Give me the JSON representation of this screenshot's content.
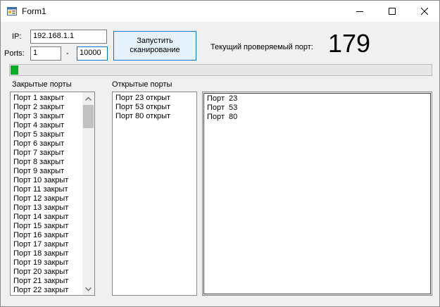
{
  "window": {
    "title": "Form1"
  },
  "form": {
    "ip_label": "IP:",
    "ip_value": "192.168.1.1",
    "ports_label": "Ports:",
    "port_from": "1",
    "port_separator": "-",
    "port_to": "10000",
    "scan_button_line1": "Запустить",
    "scan_button_line2": "сканирование",
    "current_port_label": "Текущий проверяемый порт:",
    "current_port_value": "179",
    "progress_percent": 1.8
  },
  "closed_ports": {
    "label": "Закрытые порты",
    "items": [
      "Порт 1 закрыт",
      "Порт 2 закрыт",
      "Порт 3 закрыт",
      "Порт 4 закрыт",
      "Порт 5 закрыт",
      "Порт 6 закрыт",
      "Порт 7 закрыт",
      "Порт 8 закрыт",
      "Порт 9 закрыт",
      "Порт 10 закрыт",
      "Порт 11 закрыт",
      "Порт 12 закрыт",
      "Порт 13 закрыт",
      "Порт 14 закрыт",
      "Порт 15 закрыт",
      "Порт 16 закрыт",
      "Порт 17 закрыт",
      "Порт 18 закрыт",
      "Порт 19 закрыт",
      "Порт 20 закрыт",
      "Порт 21 закрыт",
      "Порт 22 закрыт"
    ]
  },
  "open_ports": {
    "label": "Открытые порты",
    "items": [
      "Порт 23 открыт",
      "Порт 53 открыт",
      "Порт 80 открыт"
    ]
  },
  "ports_text": {
    "lines": [
      "Порт  23",
      "Порт  53",
      "Порт  80"
    ]
  },
  "icons": {
    "app": "form-app-icon",
    "minimize": "minimize-icon",
    "maximize": "maximize-icon",
    "close": "close-icon",
    "scroll_up": "chevron-up-icon",
    "scroll_down": "chevron-down-icon"
  },
  "colors": {
    "progress": "#06b025",
    "focus": "#0078d7"
  }
}
